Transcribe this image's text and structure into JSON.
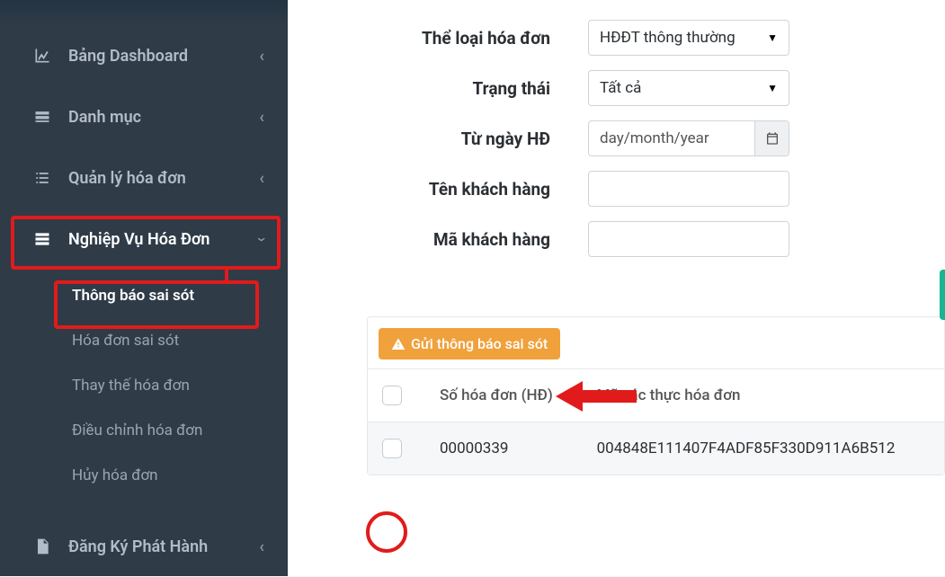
{
  "sidebar": {
    "items": [
      {
        "label": "Bảng Dashboard",
        "icon": "chart-area"
      },
      {
        "label": "Danh mục",
        "icon": "list-card"
      },
      {
        "label": "Quản lý hóa đơn",
        "icon": "list-lines"
      },
      {
        "label": "Nghiệp Vụ Hóa Đơn",
        "icon": "stack",
        "expanded": true,
        "children": [
          {
            "label": "Thông báo sai sót",
            "active": true
          },
          {
            "label": "Hóa đơn sai sót"
          },
          {
            "label": "Thay thế hóa đơn"
          },
          {
            "label": "Điều chỉnh hóa đơn"
          },
          {
            "label": "Hủy hóa đơn"
          }
        ]
      },
      {
        "label": "Đăng Ký Phát Hành",
        "icon": "file"
      }
    ]
  },
  "filters": {
    "invoice_category_label": "Thể loại hóa đơn",
    "invoice_category_value": "HĐĐT thông thường",
    "status_label": "Trạng thái",
    "status_value": "Tất cả",
    "from_date_label": "Từ ngày HĐ",
    "from_date_placeholder": "day/month/year",
    "customer_name_label": "Tên khách hàng",
    "customer_code_label": "Mã khách hàng"
  },
  "actions": {
    "send_error_notice": "Gửi thông báo sai sót"
  },
  "table": {
    "columns": {
      "c1": "Số hóa đơn (HĐ)",
      "c2": "Mã xác thực hóa đơn"
    },
    "rows": [
      {
        "invoice_no": "00000339",
        "auth_code": "004848E111407F4ADF85F330D911A6B512"
      }
    ]
  }
}
